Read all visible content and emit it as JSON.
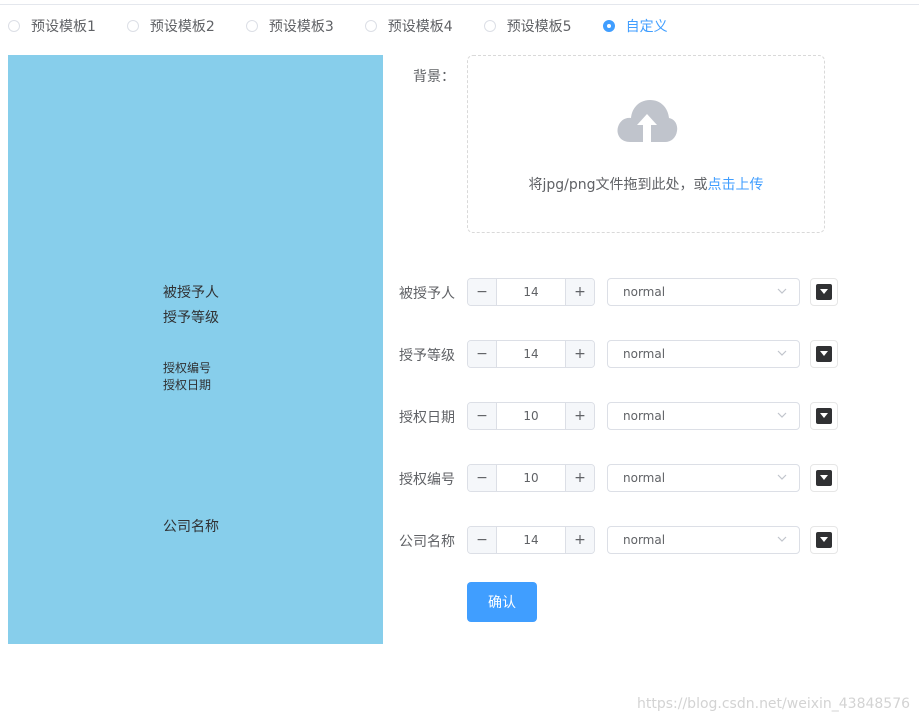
{
  "radio_group": {
    "options": [
      {
        "label": "预设模板1",
        "checked": false
      },
      {
        "label": "预设模板2",
        "checked": false
      },
      {
        "label": "预设模板3",
        "checked": false
      },
      {
        "label": "预设模板4",
        "checked": false
      },
      {
        "label": "预设模板5",
        "checked": false
      },
      {
        "label": "自定义",
        "checked": true
      }
    ]
  },
  "preview": {
    "background_color": "#87ceeb",
    "fields": {
      "grantee": "被授予人",
      "grant_level": "授予等级",
      "auth_number": "授权编号",
      "auth_date": "授权日期",
      "company_name": "公司名称"
    }
  },
  "form": {
    "background_label": "背景：",
    "upload": {
      "icon": "upload-cloud-icon",
      "text_before": "将jpg/png文件拖到此处，或",
      "text_link": "点击上传"
    },
    "rows": [
      {
        "label": "被授予人",
        "size": "14",
        "weight": "normal",
        "color": "#303133",
        "dec": "−",
        "inc": "+"
      },
      {
        "label": "授予等级",
        "size": "14",
        "weight": "normal",
        "color": "#303133",
        "dec": "−",
        "inc": "+"
      },
      {
        "label": "授权日期",
        "size": "10",
        "weight": "normal",
        "color": "#303133",
        "dec": "−",
        "inc": "+"
      },
      {
        "label": "授权编号",
        "size": "10",
        "weight": "normal",
        "color": "#303133",
        "dec": "−",
        "inc": "+"
      },
      {
        "label": "公司名称",
        "size": "14",
        "weight": "normal",
        "color": "#303133",
        "dec": "−",
        "inc": "+"
      }
    ],
    "confirm_label": "确认"
  },
  "watermark": "https://blog.csdn.net/weixin_43848576",
  "colors": {
    "accent": "#409eff",
    "border": "#dcdfe6",
    "text": "#606266"
  }
}
